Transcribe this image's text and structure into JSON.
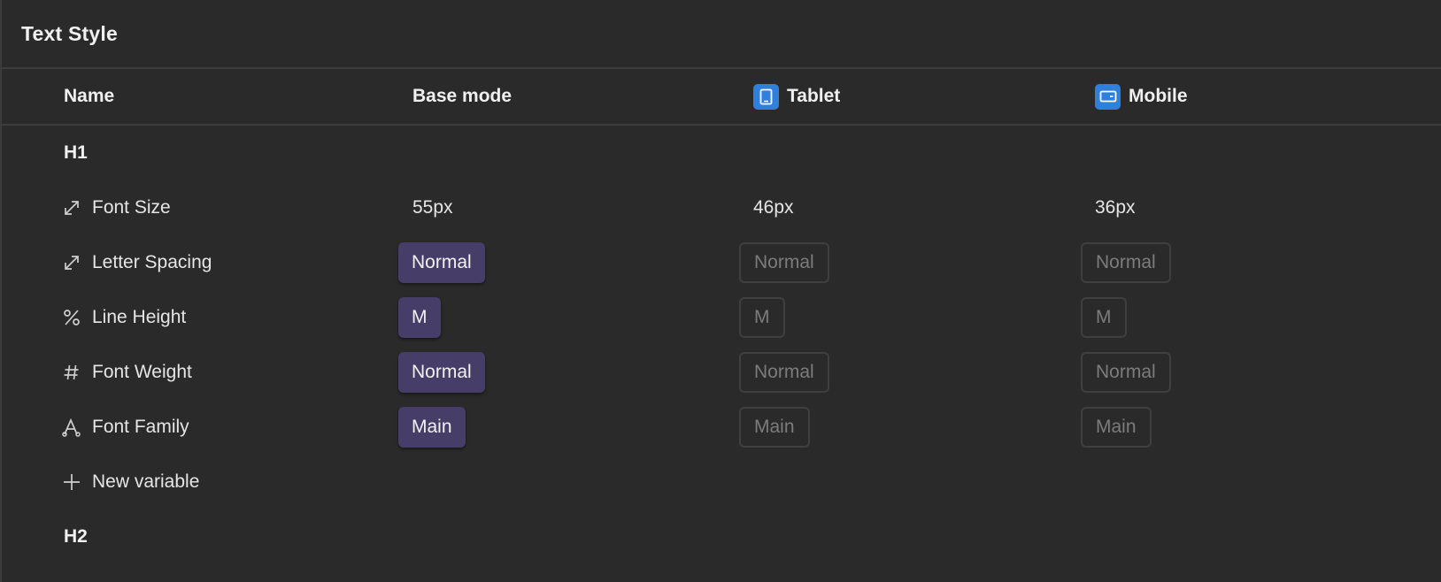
{
  "panel": {
    "title": "Text Style"
  },
  "columns": {
    "name": "Name",
    "base": "Base mode",
    "tablet": "Tablet",
    "mobile": "Mobile"
  },
  "icons": {
    "tablet": "tablet-icon",
    "mobile": "mobile-icon",
    "font_size": "resize-arrow-icon",
    "letter_spacing": "resize-arrow-icon",
    "line_height": "percent-icon",
    "font_weight": "hash-icon",
    "font_family": "font-family-icon",
    "new_variable": "plus-icon"
  },
  "colors": {
    "background": "#2a2a2a",
    "active_pill": "#463e68",
    "device_icon": "#2f7fdc"
  },
  "groups": [
    {
      "label": "H1",
      "rows": [
        {
          "name": "Font Size",
          "base": "55px",
          "tablet": "46px",
          "mobile": "36px"
        },
        {
          "name": "Letter Spacing",
          "base": "Normal",
          "tablet": "Normal",
          "mobile": "Normal"
        },
        {
          "name": "Line Height",
          "base": "M",
          "tablet": "M",
          "mobile": "M"
        },
        {
          "name": "Font Weight",
          "base": "Normal",
          "tablet": "Normal",
          "mobile": "Normal"
        },
        {
          "name": "Font Family",
          "base": "Main",
          "tablet": "Main",
          "mobile": "Main"
        }
      ],
      "new_variable_label": "New variable"
    },
    {
      "label": "H2"
    }
  ]
}
